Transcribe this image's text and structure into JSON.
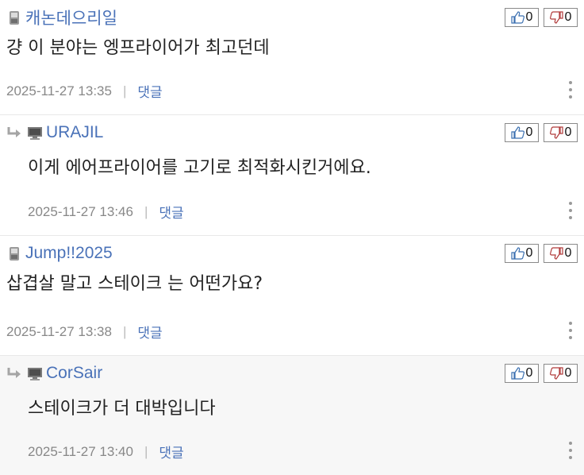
{
  "comments": [
    {
      "nick": "캐논데으리일",
      "text": "걍 이 분야는 엥프라이어가 최고던데",
      "time": "2025-11-27 13:35",
      "up": "0",
      "down": "0",
      "reply_label": "댓글"
    },
    {
      "nick": "URAJIL",
      "text": "이게 에어프라이어를 고기로 최적화시킨거에요.",
      "time": "2025-11-27 13:46",
      "up": "0",
      "down": "0",
      "reply_label": "댓글"
    },
    {
      "nick": "Jump!!2025",
      "text": "삽겹살 말고 스테이크 는 어떤가요?",
      "time": "2025-11-27 13:38",
      "up": "0",
      "down": "0",
      "reply_label": "댓글"
    },
    {
      "nick": "CorSair",
      "text": "스테이크가 더 대박입니다",
      "time": "2025-11-27 13:40",
      "up": "0",
      "down": "0",
      "reply_label": "댓글"
    }
  ],
  "separator": "|",
  "icons": {
    "mobile": "mobile-phone-icon",
    "pc": "monitor-icon",
    "reply": "reply-arrow-icon",
    "up": "thumbs-up-icon",
    "down": "thumbs-down-icon",
    "more": "more-vertical-icon"
  }
}
